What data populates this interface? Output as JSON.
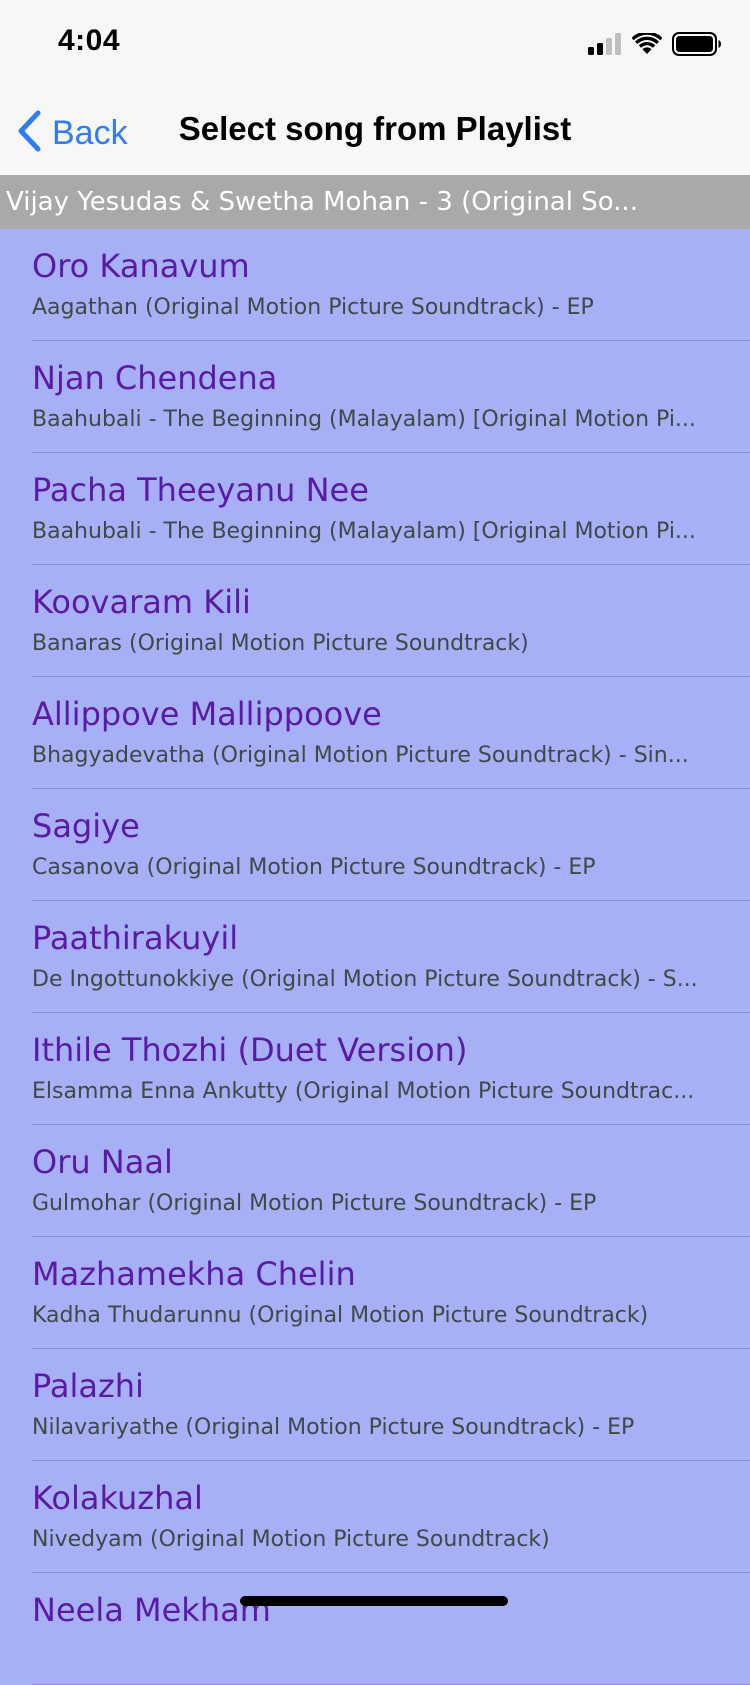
{
  "status_bar": {
    "time": "4:04",
    "icons": [
      "cellular-signal-icon",
      "wifi-icon",
      "battery-icon"
    ]
  },
  "nav": {
    "back_label": "Back",
    "title": "Select song from Playlist"
  },
  "section_header": "Vijay Yesudas & Swetha Mohan - 3 (Original So...",
  "songs": [
    {
      "title": "Oro Kanavum",
      "subtitle": "Aagathan (Original Motion Picture Soundtrack) - EP"
    },
    {
      "title": "Njan Chendena",
      "subtitle": "Baahubali - The Beginning (Malayalam) [Original Motion Pi..."
    },
    {
      "title": "Pacha Theeyanu Nee",
      "subtitle": "Baahubali - The Beginning (Malayalam) [Original Motion Pi..."
    },
    {
      "title": "Koovaram Kili",
      "subtitle": "Banaras (Original Motion Picture Soundtrack)"
    },
    {
      "title": "Allippove Mallippoove",
      "subtitle": "Bhagyadevatha (Original Motion Picture Soundtrack) - Sin..."
    },
    {
      "title": "Sagiye",
      "subtitle": "Casanova (Original Motion Picture Soundtrack) - EP"
    },
    {
      "title": "Paathirakuyil",
      "subtitle": "De Ingottunokkiye (Original Motion Picture Soundtrack) - S..."
    },
    {
      "title": "Ithile Thozhi (Duet Version)",
      "subtitle": "Elsamma Enna Ankutty (Original Motion Picture Soundtrac..."
    },
    {
      "title": "Oru Naal",
      "subtitle": "Gulmohar (Original Motion Picture Soundtrack) - EP"
    },
    {
      "title": "Mazhamekha Chelin",
      "subtitle": "Kadha Thudarunnu (Original Motion Picture Soundtrack)"
    },
    {
      "title": "Palazhi",
      "subtitle": "Nilavariyathe (Original Motion Picture Soundtrack) - EP"
    },
    {
      "title": "Kolakuzhal",
      "subtitle": "Nivedyam (Original Motion Picture Soundtrack)"
    },
    {
      "title": "Neela Mekham",
      "subtitle": ""
    }
  ],
  "colors": {
    "list_background": "#a7b0f7",
    "title_text": "#5a1aa6",
    "subtitle_text": "#3d4a45",
    "section_header_bg": "#a9a9a9",
    "accent": "#2f7cf6"
  }
}
